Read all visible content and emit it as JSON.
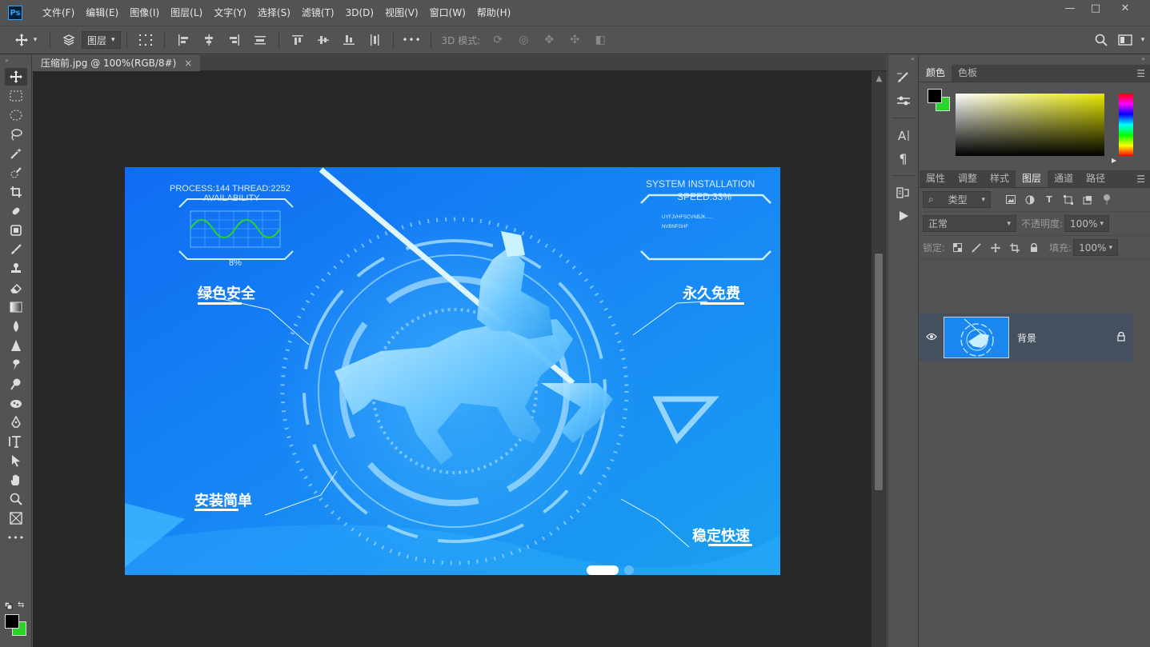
{
  "app": {
    "logo": "Ps"
  },
  "menu": [
    "文件(F)",
    "编辑(E)",
    "图像(I)",
    "图层(L)",
    "文字(Y)",
    "选择(S)",
    "滤镜(T)",
    "3D(D)",
    "视图(V)",
    "窗口(W)",
    "帮助(H)"
  ],
  "window_controls": {
    "collapse": "▭",
    "minimize": "—",
    "restore": "□",
    "close": "✕"
  },
  "options": {
    "select_value": "图层",
    "mode_label": "3D 模式:",
    "more": "•••"
  },
  "document": {
    "tab_title": "压缩前.jpg @ 100%(RGB/8#)",
    "tab_close": "×"
  },
  "image": {
    "process": "PROCESS:144  THREAD:2252",
    "availability": "AVAILABILITY",
    "avail_percent": "8%",
    "system": "SYSTEM INSTALLATION",
    "speed": "SPEED:33%",
    "code1": "UYFJVHFSCVNBJK.....",
    "code2": "NVBNFGHF",
    "feature_tl": "绿色安全",
    "feature_tr": "永久免费",
    "feature_bl": "安装简单",
    "feature_br": "稳定快速"
  },
  "panels": {
    "color_tabs": [
      "颜色",
      "色板"
    ],
    "layer_tabs": [
      "属性",
      "调整",
      "样式",
      "图层",
      "通道",
      "路径"
    ],
    "filter_label": "类型",
    "blend_mode": "正常",
    "opacity_label": "不透明度:",
    "opacity_value": "100%",
    "lock_label": "锁定:",
    "fill_label": "填充:",
    "fill_value": "100%",
    "layer_name": "背景"
  },
  "colors": {
    "foreground": "#000000",
    "background": "#2bd42b",
    "accent": "#0a7ff0"
  }
}
